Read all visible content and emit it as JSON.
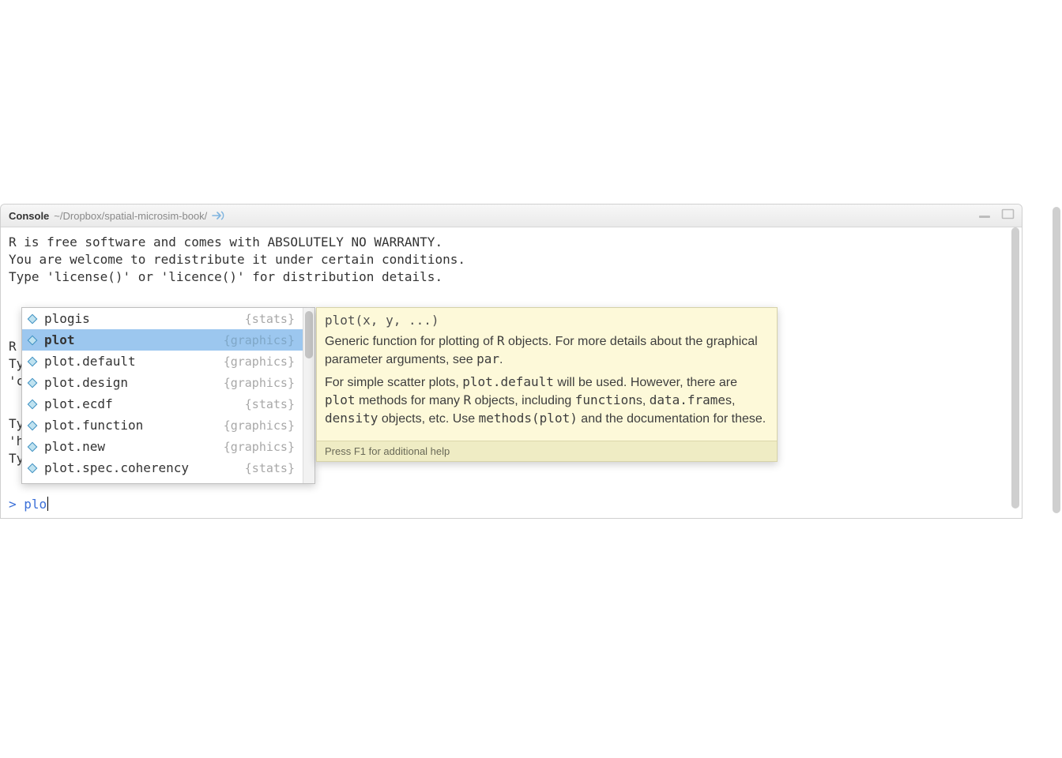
{
  "header": {
    "title": "Console",
    "path": "~/Dropbox/spatial-microsim-book/"
  },
  "startup_lines": [
    "R is free software and comes with ABSOLUTELY NO WARRANTY.",
    "You are welcome to redistribute it under certain conditions.",
    "Type 'license()' or 'licence()' for distribution details."
  ],
  "bg_lines": {
    "l1": "R",
    "l2": "Ty",
    "l3": "'c",
    "l4": "Ty",
    "l5": "'h",
    "l6": "Ty"
  },
  "prompt": {
    "symbol": "> ",
    "typed": "plo"
  },
  "autocomplete": {
    "items": [
      {
        "name": "plogis",
        "pkg": "{stats}",
        "selected": false
      },
      {
        "name": "plot",
        "pkg": "{graphics}",
        "selected": true
      },
      {
        "name": "plot.default",
        "pkg": "{graphics}",
        "selected": false
      },
      {
        "name": "plot.design",
        "pkg": "{graphics}",
        "selected": false
      },
      {
        "name": "plot.ecdf",
        "pkg": "{stats}",
        "selected": false
      },
      {
        "name": "plot.function",
        "pkg": "{graphics}",
        "selected": false
      },
      {
        "name": "plot.new",
        "pkg": "{graphics}",
        "selected": false
      },
      {
        "name": "plot.spec.coherency",
        "pkg": "{stats}",
        "selected": false
      }
    ]
  },
  "help": {
    "signature": "plot(x, y, ...)",
    "p1_a": "Generic function for plotting of ",
    "p1_code1": "R",
    "p1_b": " objects. For more details about the graphical parameter arguments, see ",
    "p1_code2": "par",
    "p1_c": ".",
    "p2_a": "For simple scatter plots, ",
    "p2_code1": "plot.default",
    "p2_b": " will be used. However, there are ",
    "p2_code2": "plot",
    "p2_c": " methods for many ",
    "p2_code3": "R",
    "p2_d": " objects, including ",
    "p2_code4": "function",
    "p2_e": "s, ",
    "p2_code5": "data.frame",
    "p2_f": "s, ",
    "p2_code6": "density",
    "p2_g": " objects, etc. Use ",
    "p2_code7": "methods(plot)",
    "p2_h": " and the documentation for these.",
    "footer": "Press F1 for additional help"
  }
}
